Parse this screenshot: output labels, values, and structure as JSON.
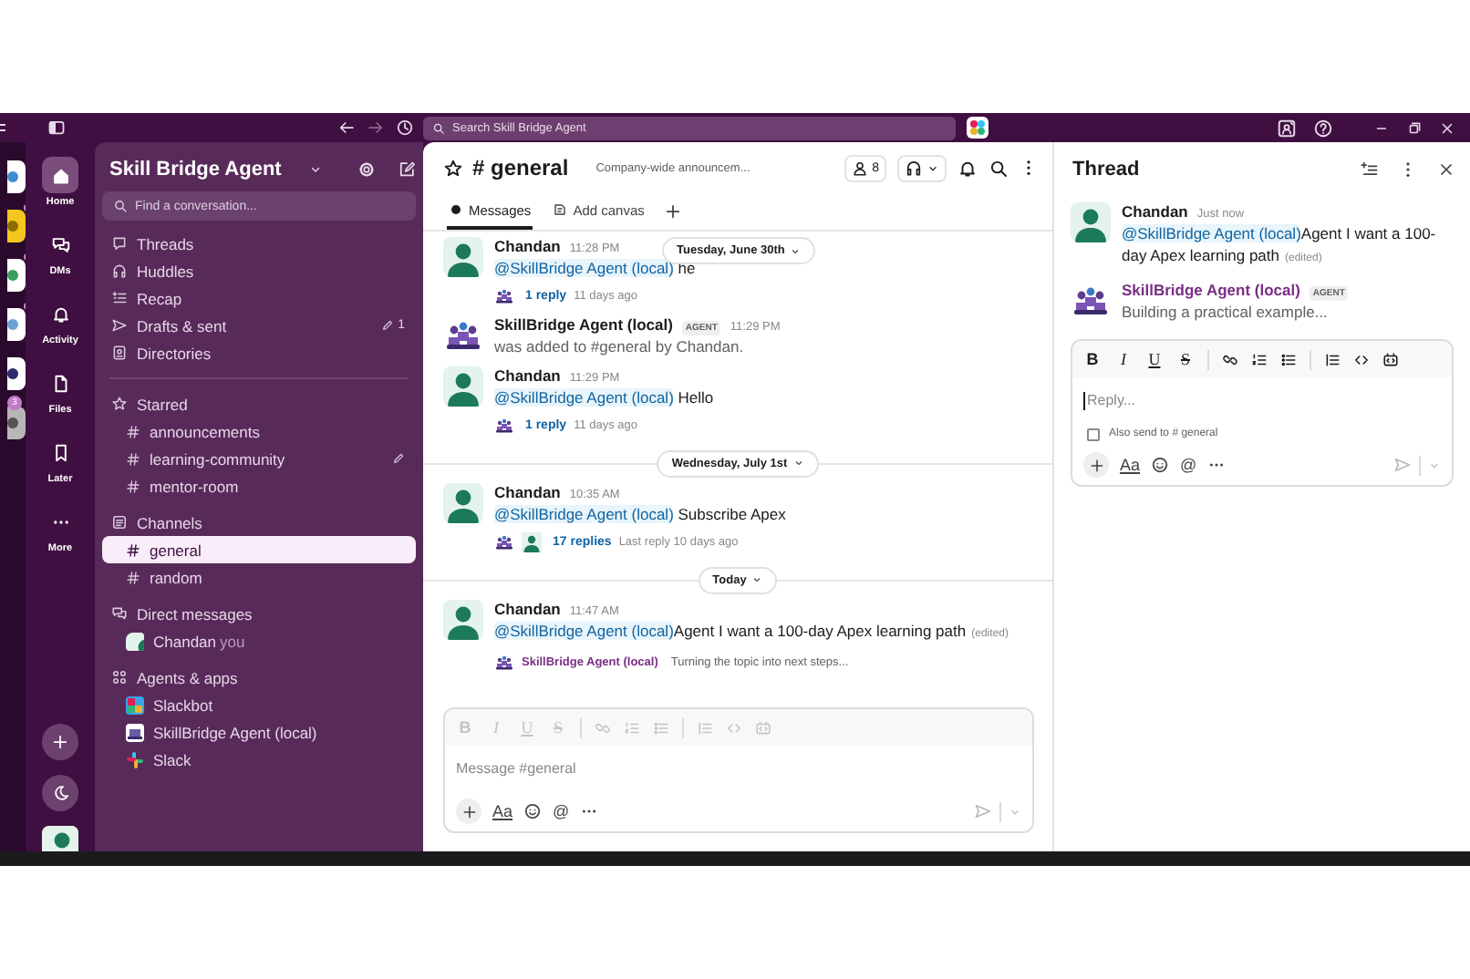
{
  "titlebar": {
    "search_placeholder": "Search Skill Bridge Agent"
  },
  "workspaces": [
    {
      "unread": false
    },
    {
      "unread": true
    },
    {
      "unread": true
    },
    {
      "unread": true
    },
    {
      "unread": false
    },
    {
      "unread": false,
      "badge": "3"
    }
  ],
  "rail": {
    "items": [
      {
        "label": "Home",
        "selected": true
      },
      {
        "label": "DMs",
        "selected": false
      },
      {
        "label": "Activity",
        "selected": false
      },
      {
        "label": "Files",
        "selected": false
      },
      {
        "label": "Later",
        "selected": false
      },
      {
        "label": "More",
        "selected": false
      }
    ]
  },
  "sidebar": {
    "workspace": "Skill Bridge Agent",
    "search_placeholder": "Find a conversation...",
    "nav": [
      {
        "label": "Threads"
      },
      {
        "label": "Huddles"
      },
      {
        "label": "Recap"
      },
      {
        "label": "Drafts & sent",
        "count": "1"
      },
      {
        "label": "Directories"
      }
    ],
    "sections": [
      {
        "title": "Starred",
        "kind": "starred",
        "items": [
          {
            "label": "announcements",
            "selected": false,
            "draft": false
          },
          {
            "label": "learning-community",
            "selected": false,
            "draft": true
          },
          {
            "label": "mentor-room",
            "selected": false,
            "draft": false
          }
        ]
      },
      {
        "title": "Channels",
        "kind": "channels",
        "items": [
          {
            "label": "general",
            "selected": true,
            "draft": false
          },
          {
            "label": "random",
            "selected": false,
            "draft": false
          }
        ]
      },
      {
        "title": "Direct messages",
        "kind": "people",
        "items": [
          {
            "label": "Chandan",
            "suffix": "you",
            "selected": false,
            "draft": false
          }
        ]
      },
      {
        "title": "Agents & apps",
        "kind": "apps",
        "items": [
          {
            "label": "Slackbot",
            "selected": false,
            "draft": false
          },
          {
            "label": "SkillBridge Agent (local)",
            "selected": false,
            "draft": false
          },
          {
            "label": "Slack",
            "selected": false,
            "draft": false
          }
        ]
      }
    ]
  },
  "channel": {
    "title": "# general",
    "topic": "Company-wide announcem...",
    "member_count": "8",
    "tabs": [
      {
        "label": "Messages",
        "selected": true
      },
      {
        "label": "Add canvas",
        "selected": false
      }
    ]
  },
  "sticky_date": "Tuesday, June 30th",
  "feed": [
    {
      "kind": "message",
      "author": "Chandan",
      "avatar": {
        "kind": "user"
      },
      "time": "11:28 PM",
      "mention": "@SkillBridge Agent (local)",
      "text": " he",
      "thread": {
        "participants": [
          {
            "kind": "agent"
          }
        ],
        "replies": "1 reply",
        "last": "11 days ago"
      }
    },
    {
      "kind": "message",
      "author": "SkillBridge Agent (local)",
      "avatar": {
        "kind": "agent"
      },
      "badge": "AGENT",
      "time": "11:29 PM",
      "text": "was added to #general by Chandan.",
      "muted": true
    },
    {
      "kind": "message",
      "author": "Chandan",
      "avatar": {
        "kind": "user"
      },
      "time": "11:29 PM",
      "mention": "@SkillBridge Agent (local)",
      "text": " Hello",
      "thread": {
        "participants": [
          {
            "kind": "agent"
          }
        ],
        "replies": "1 reply",
        "last": "11 days ago"
      }
    },
    {
      "kind": "divider",
      "label": "Wednesday, July 1st"
    },
    {
      "kind": "message",
      "author": "Chandan",
      "avatar": {
        "kind": "user"
      },
      "time": "10:35 AM",
      "mention": "@SkillBridge Agent (local)",
      "text": " Subscribe Apex",
      "thread": {
        "participants": [
          {
            "kind": "agent"
          },
          {
            "kind": "user"
          }
        ],
        "replies": "17 replies",
        "last": "Last reply 10 days ago"
      }
    },
    {
      "kind": "divider",
      "label": "Today"
    },
    {
      "kind": "message",
      "author": "Chandan",
      "avatar": {
        "kind": "user"
      },
      "time": "11:47 AM",
      "mention": "@SkillBridge Agent (local)",
      "text": "Agent I want a 100-day Apex learning path",
      "edited": "(edited)",
      "preview": {
        "author": "SkillBridge Agent (local)",
        "text": "Turning the topic into next steps..."
      }
    }
  ],
  "composer": {
    "letters": [
      "B",
      "I",
      "U",
      "S"
    ],
    "placeholder": "Message #general",
    "format": "Aa",
    "mention": "@",
    "disabled": true,
    "focused": false
  },
  "thread": {
    "title": "Thread",
    "messages": [
      {
        "author": "Chandan",
        "avatar": {
          "kind": "user"
        },
        "time": "Just now",
        "mention": "@SkillBridge Agent (local)",
        "text": "Agent I want a 100-day Apex learning path",
        "edited": "(edited)",
        "accent": false
      },
      {
        "author": "SkillBridge Agent (local)",
        "avatar": {
          "kind": "agent"
        },
        "badge": "AGENT",
        "text": "Building a practical example...",
        "accent": true,
        "muted": true
      }
    ],
    "composer": {
      "letters": [
        "B",
        "I",
        "U",
        "S"
      ],
      "placeholder": "Reply...",
      "format": "Aa",
      "mention": "@",
      "disabled": false,
      "focused": true,
      "also_send": {
        "label": "Also send to # general",
        "checked": false
      }
    }
  }
}
